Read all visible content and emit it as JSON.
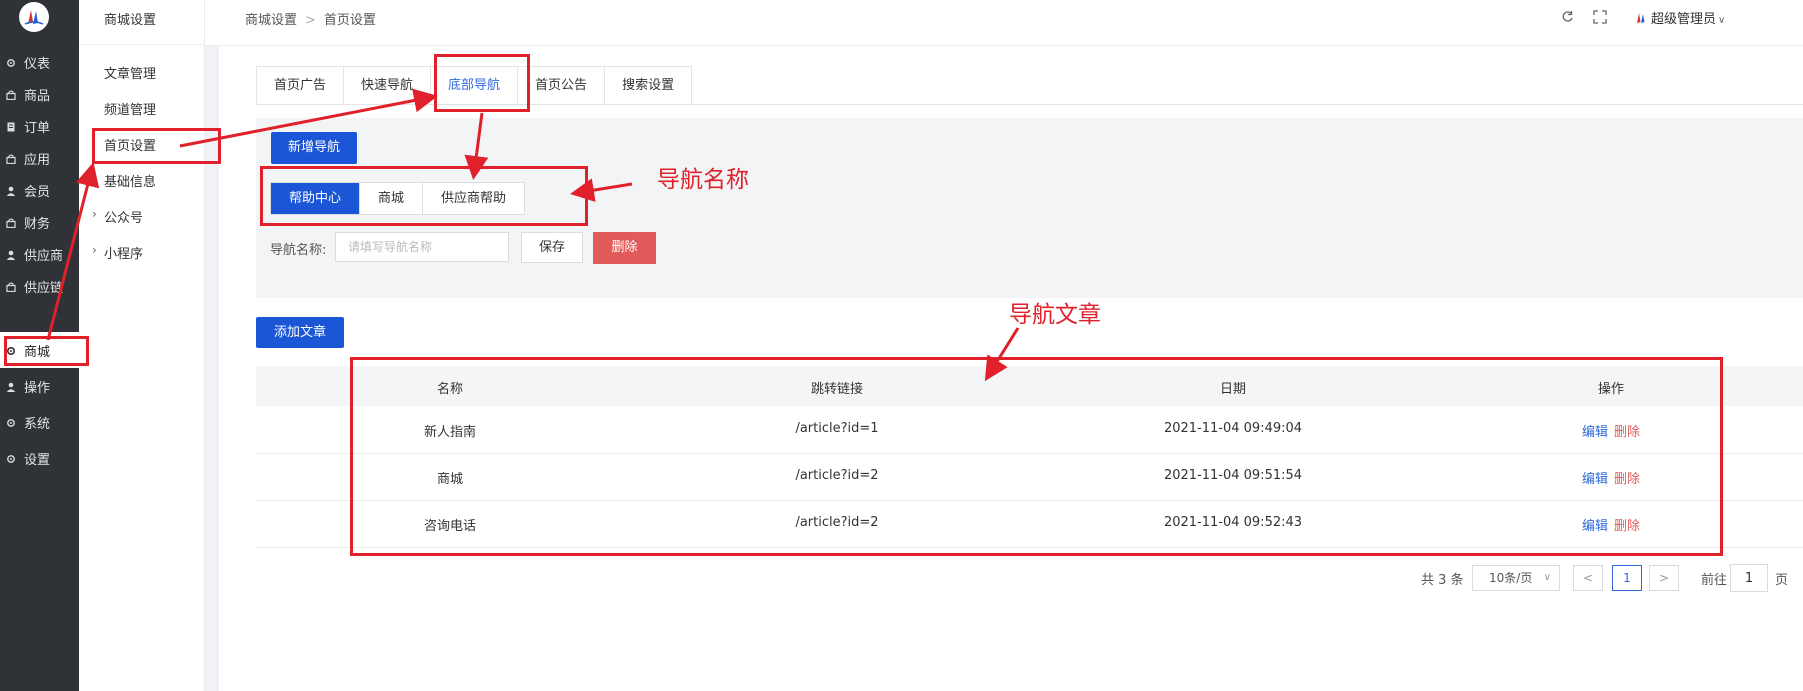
{
  "rail": {
    "items": [
      {
        "label": "仪表",
        "icon": "gear-icon"
      },
      {
        "label": "商品",
        "icon": "bag-icon"
      },
      {
        "label": "订单",
        "icon": "document-icon"
      },
      {
        "label": "应用",
        "icon": "bag-icon"
      },
      {
        "label": "会员",
        "icon": "user-icon"
      },
      {
        "label": "财务",
        "icon": "bag-icon"
      },
      {
        "label": "供应商",
        "icon": "user-icon"
      },
      {
        "label": "供应链",
        "icon": "bag-icon"
      },
      {
        "label": "商城",
        "icon": "gear-icon"
      },
      {
        "label": "操作",
        "icon": "user-icon"
      },
      {
        "label": "系统",
        "icon": "gear-icon"
      },
      {
        "label": "设置",
        "icon": "gear-icon"
      }
    ]
  },
  "sub": {
    "title": "商城设置",
    "items": [
      "文章管理",
      "频道管理",
      "首页设置",
      "基础信息",
      "公众号",
      "小程序"
    ]
  },
  "breadcrumb": {
    "first": "商城设置",
    "sep": ">",
    "second": "首页设置"
  },
  "user": {
    "name": "超级管理员"
  },
  "tabs": [
    "首页广告",
    "快速导航",
    "底部导航",
    "首页公告",
    "搜索设置"
  ],
  "add_nav_label": "新增导航",
  "nav_tabs": [
    "帮助中心",
    "商城",
    "供应商帮助"
  ],
  "form": {
    "label": "导航名称:",
    "placeholder": "请填写导航名称",
    "save": "保存",
    "delete": "删除"
  },
  "add_article_label": "添加文章",
  "table": {
    "headers": [
      "名称",
      "跳转链接",
      "日期",
      "操作"
    ],
    "rows": [
      {
        "name": "新人指南",
        "link": "/article?id=1",
        "date": "2021-11-04 09:49:04"
      },
      {
        "name": "商城",
        "link": "/article?id=2",
        "date": "2021-11-04 09:51:54"
      },
      {
        "name": "咨询电话",
        "link": "/article?id=2",
        "date": "2021-11-04 09:52:43"
      }
    ],
    "edit": "编辑",
    "delete": "删除"
  },
  "pagination": {
    "total": "共 3 条",
    "page_size": "10条/页",
    "prev": "<",
    "current": "1",
    "next": ">",
    "goto": "前往",
    "goto_value": "1",
    "unit": "页"
  },
  "annotations": {
    "nav_name": "导航名称",
    "nav_articles": "导航文章"
  },
  "colors": {
    "primary": "#1a56d6",
    "danger": "#e25a5a",
    "annotation": "#e0202a",
    "rail_bg": "#2f3237"
  }
}
